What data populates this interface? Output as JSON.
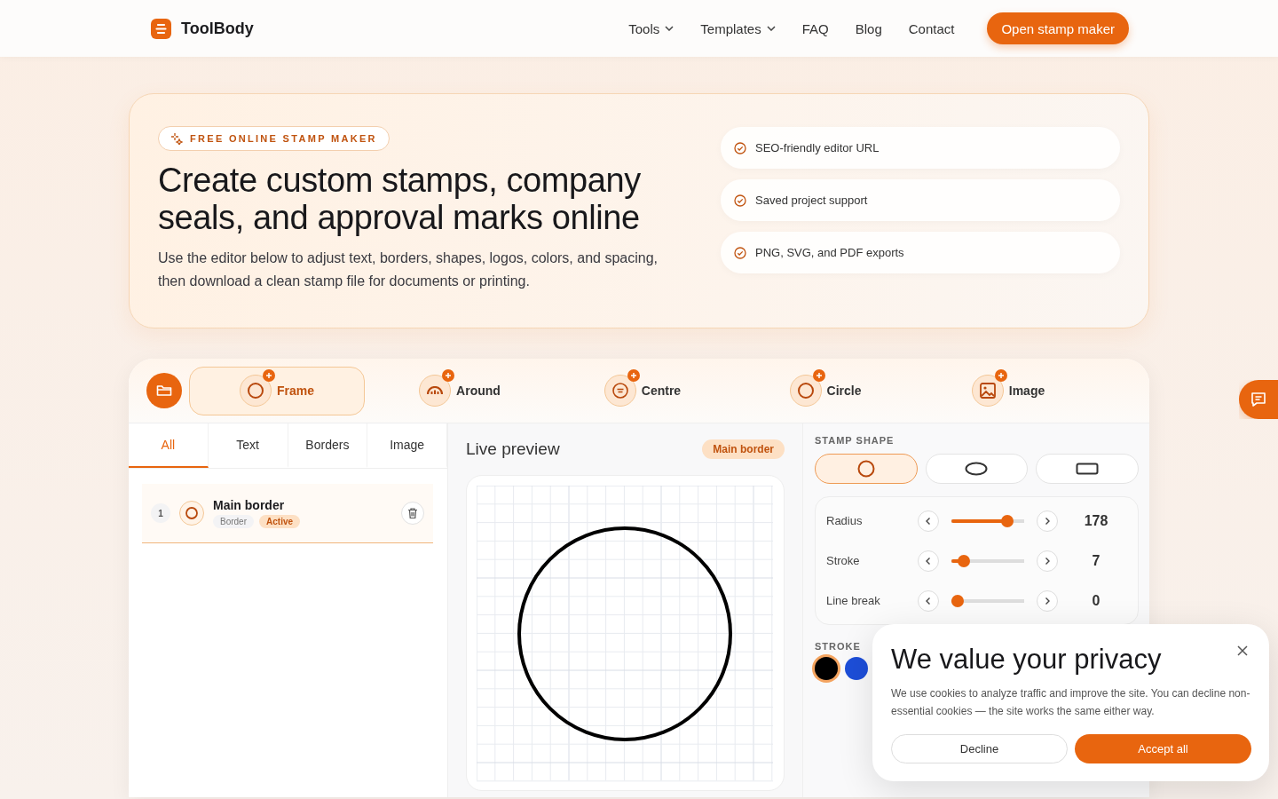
{
  "brand": {
    "name": "ToolBody"
  },
  "nav": {
    "items": [
      {
        "label": "Tools",
        "dropdown": true
      },
      {
        "label": "Templates",
        "dropdown": true
      },
      {
        "label": "FAQ",
        "dropdown": false
      },
      {
        "label": "Blog",
        "dropdown": false
      },
      {
        "label": "Contact",
        "dropdown": false
      }
    ],
    "cta": "Open stamp maker"
  },
  "hero": {
    "badge": "FREE ONLINE STAMP MAKER",
    "title": "Create custom stamps, company seals, and approval marks online",
    "description": "Use the editor below to adjust text, borders, shapes, logos, colors, and spacing, then download a clean stamp file for documents or printing.",
    "features": [
      "SEO-friendly editor URL",
      "Saved project support",
      "PNG, SVG, and PDF exports"
    ]
  },
  "editor": {
    "tools": [
      {
        "label": "Frame",
        "kind": "frame",
        "selected": true
      },
      {
        "label": "Around",
        "kind": "around",
        "selected": false
      },
      {
        "label": "Centre",
        "kind": "centre",
        "selected": false
      },
      {
        "label": "Circle",
        "kind": "circle",
        "selected": false
      },
      {
        "label": "Image",
        "kind": "image",
        "selected": false
      }
    ],
    "layer_tabs": [
      {
        "label": "All",
        "selected": true
      },
      {
        "label": "Text",
        "selected": false
      },
      {
        "label": "Borders",
        "selected": false
      },
      {
        "label": "Image",
        "selected": false
      }
    ],
    "layers": [
      {
        "number": "1",
        "name": "Main border",
        "type": "Border",
        "status": "Active"
      }
    ],
    "preview": {
      "title": "Live preview",
      "badge": "Main border"
    },
    "stamp_shape": {
      "label": "STAMP SHAPE",
      "options": [
        {
          "kind": "circle",
          "selected": true
        },
        {
          "kind": "ellipse",
          "selected": false
        },
        {
          "kind": "rectangle",
          "selected": false
        }
      ]
    },
    "sliders": [
      {
        "label": "Radius",
        "level": 0.82,
        "value": "178"
      },
      {
        "label": "Stroke",
        "level": 0.1,
        "value": "7"
      },
      {
        "label": "Line break",
        "level": 0,
        "value": "0"
      }
    ],
    "stroke_color": {
      "label": "STROKE",
      "swatches": [
        {
          "color": "#000000",
          "selected": true
        },
        {
          "color": "#1d4ed8",
          "selected": false
        }
      ]
    }
  },
  "cookie": {
    "title": "We value your privacy",
    "text": "We use cookies to analyze traffic and improve the site. You can decline non-essential cookies — the site works the same either way.",
    "buttons": [
      {
        "label": "Decline",
        "kind": "secondary"
      },
      {
        "label": "Accept all",
        "kind": "primary"
      }
    ]
  }
}
